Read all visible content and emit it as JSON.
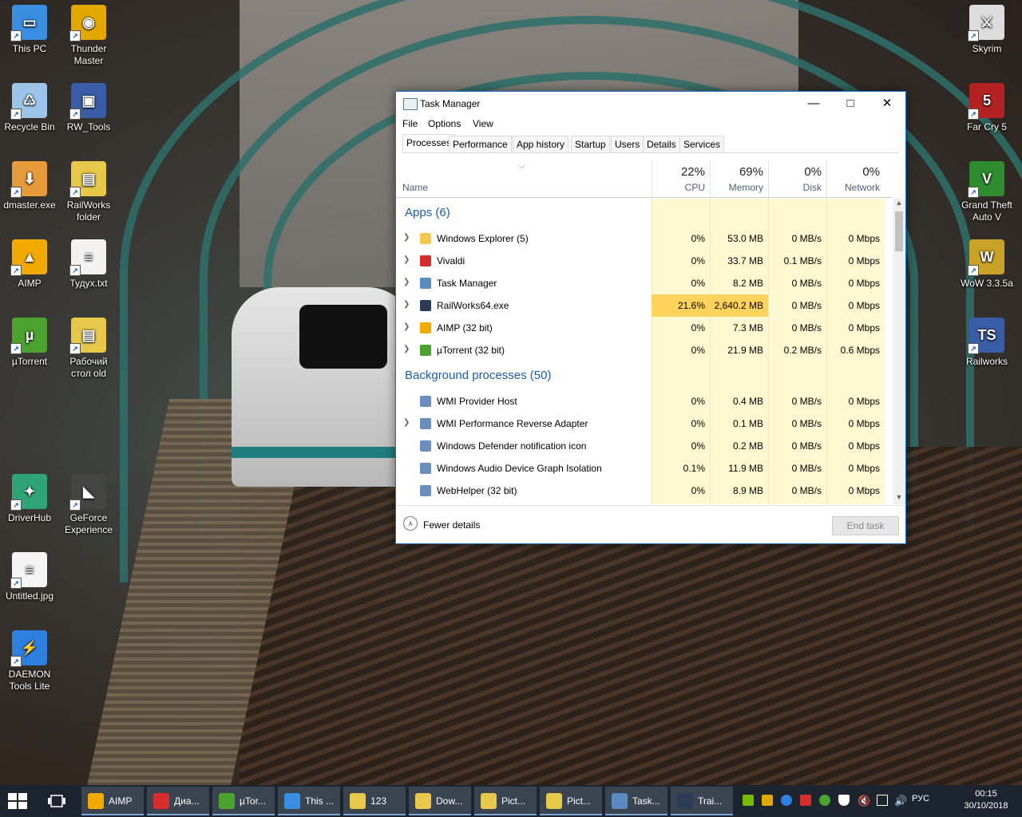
{
  "desktop": {
    "left_icons": [
      {
        "label": "This PC",
        "color": "#3a8de0",
        "glyph": "▭"
      },
      {
        "label": "Thunder\nMaster",
        "color": "#e2a800",
        "glyph": "◉"
      },
      {
        "label": "Recycle Bin",
        "color": "#9cc4e8",
        "glyph": "♺"
      },
      {
        "label": "RW_Tools",
        "color": "#3a5da8",
        "glyph": "▣"
      },
      {
        "label": "dmaster.exe",
        "color": "#e69a3a",
        "glyph": "⬇"
      },
      {
        "label": "RailWorks\nfolder",
        "color": "#e8c84a",
        "glyph": "▤"
      },
      {
        "label": "AIMP",
        "color": "#f2a900",
        "glyph": "▲"
      },
      {
        "label": "Тудух.txt",
        "color": "#f2f2f2",
        "glyph": "≡"
      },
      {
        "label": "µTorrent",
        "color": "#4ca22e",
        "glyph": "µ"
      },
      {
        "label": "Рабочий\nстол old",
        "color": "#e8c84a",
        "glyph": "▤"
      },
      {
        "label": "DriverHub",
        "color": "#2fa37a",
        "glyph": "✦"
      },
      {
        "label": "GeForce\nExperience",
        "color": "#444444",
        "glyph": "◣"
      },
      {
        "label": "Untitled.jpg",
        "color": "#f4f4f4",
        "glyph": "≡"
      },
      {
        "label": "DAEMON\nTools Lite",
        "color": "#2f7fe0",
        "glyph": "⚡"
      }
    ],
    "right_icons": [
      {
        "label": "Skyrim",
        "color": "#dddddd",
        "glyph": "⚔"
      },
      {
        "label": "Far Cry 5",
        "color": "#b22222",
        "glyph": "5"
      },
      {
        "label": "Grand Theft\nAuto V",
        "color": "#2e8b2e",
        "glyph": "V"
      },
      {
        "label": "WoW 3.3.5a",
        "color": "#c9a227",
        "glyph": "W"
      },
      {
        "label": "Railworks",
        "color": "#3a5da8",
        "glyph": "TS"
      }
    ]
  },
  "task_manager": {
    "title": "Task Manager",
    "menu": [
      "File",
      "Options",
      "View"
    ],
    "tabs": [
      "Processes",
      "Performance",
      "App history",
      "Startup",
      "Users",
      "Details",
      "Services"
    ],
    "active_tab": "Processes",
    "columns": {
      "name": "Name",
      "cpu": {
        "pct": "22%",
        "label": "CPU"
      },
      "memory": {
        "pct": "69%",
        "label": "Memory"
      },
      "disk": {
        "pct": "0%",
        "label": "Disk"
      },
      "network": {
        "pct": "0%",
        "label": "Network"
      }
    },
    "groups": [
      {
        "title": "Apps (6)",
        "rows": [
          {
            "name": "Windows Explorer (5)",
            "cpu": "0%",
            "mem": "53.0 MB",
            "disk": "0 MB/s",
            "net": "0 Mbps",
            "expand": true,
            "icon": "#f2c94c",
            "hot": false
          },
          {
            "name": "Vivaldi",
            "cpu": "0%",
            "mem": "33.7 MB",
            "disk": "0.1 MB/s",
            "net": "0 Mbps",
            "expand": true,
            "icon": "#d62c2c",
            "hot": false
          },
          {
            "name": "Task Manager",
            "cpu": "0%",
            "mem": "8.2 MB",
            "disk": "0 MB/s",
            "net": "0 Mbps",
            "expand": true,
            "icon": "#5a8ac0",
            "hot": false
          },
          {
            "name": "RailWorks64.exe",
            "cpu": "21.6%",
            "mem": "2,640.2 MB",
            "disk": "0 MB/s",
            "net": "0 Mbps",
            "expand": true,
            "icon": "#2b3a55",
            "hot": true
          },
          {
            "name": "AIMP (32 bit)",
            "cpu": "0%",
            "mem": "7.3 MB",
            "disk": "0 MB/s",
            "net": "0 Mbps",
            "expand": true,
            "icon": "#f2a900",
            "hot": false
          },
          {
            "name": "µTorrent (32 bit)",
            "cpu": "0%",
            "mem": "21.9 MB",
            "disk": "0.2 MB/s",
            "net": "0.6 Mbps",
            "expand": true,
            "icon": "#4ca22e",
            "hot": false
          }
        ]
      },
      {
        "title": "Background processes (50)",
        "rows": [
          {
            "name": "WMI Provider Host",
            "cpu": "0%",
            "mem": "0.4 MB",
            "disk": "0 MB/s",
            "net": "0 Mbps",
            "expand": false,
            "icon": "#6a8fbf",
            "hot": false
          },
          {
            "name": "WMI Performance Reverse Adapter",
            "cpu": "0%",
            "mem": "0.1 MB",
            "disk": "0 MB/s",
            "net": "0 Mbps",
            "expand": true,
            "icon": "#6a8fbf",
            "hot": false
          },
          {
            "name": "Windows Defender notification icon",
            "cpu": "0%",
            "mem": "0.2 MB",
            "disk": "0 MB/s",
            "net": "0 Mbps",
            "expand": false,
            "icon": "#6a8fbf",
            "hot": false
          },
          {
            "name": "Windows Audio Device Graph Isolation",
            "cpu": "0.1%",
            "mem": "11.9 MB",
            "disk": "0 MB/s",
            "net": "0 Mbps",
            "expand": false,
            "icon": "#6a8fbf",
            "hot": false
          },
          {
            "name": "WebHelper (32 bit)",
            "cpu": "0%",
            "mem": "8.9 MB",
            "disk": "0 MB/s",
            "net": "0 Mbps",
            "expand": false,
            "icon": "#6a8fbf",
            "hot": false
          }
        ]
      }
    ],
    "fewer_details": "Fewer details",
    "end_task": "End task"
  },
  "taskbar": {
    "items": [
      {
        "label": "AIMP",
        "color": "#f2a900"
      },
      {
        "label": "Диа...",
        "color": "#d62c2c"
      },
      {
        "label": "µTor...",
        "color": "#4ca22e"
      },
      {
        "label": "This ...",
        "color": "#3a8de0"
      },
      {
        "label": "123",
        "color": "#e8c84a"
      },
      {
        "label": "Dow...",
        "color": "#e8c84a"
      },
      {
        "label": "Pict...",
        "color": "#e8c84a"
      },
      {
        "label": "Pict...",
        "color": "#e8c84a"
      },
      {
        "label": "Task...",
        "color": "#5a8ac0"
      },
      {
        "label": "Trai...",
        "color": "#2b3a55"
      }
    ],
    "language": "РУС",
    "time": "00:15",
    "date": "30/10/2018"
  }
}
